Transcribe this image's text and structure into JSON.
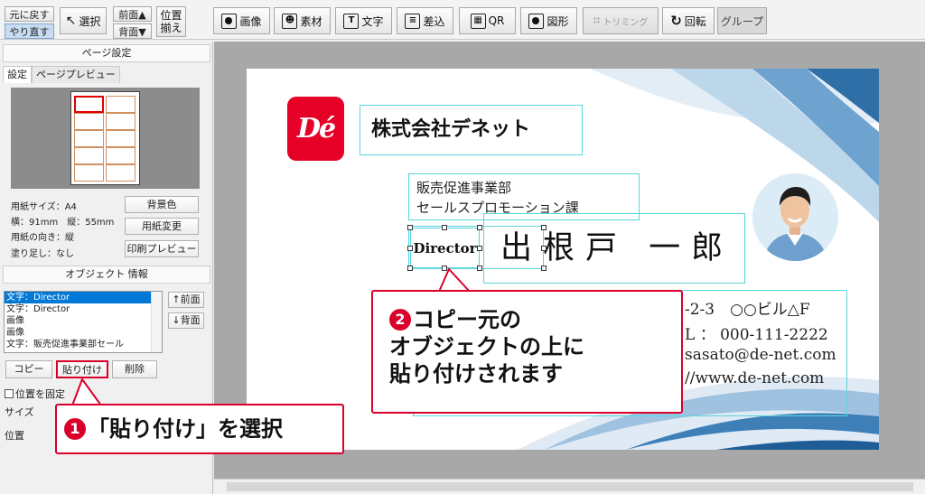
{
  "toolbar": {
    "undo": "元に戻す",
    "redo": "やり直す",
    "select": "選択",
    "bring_front": "前面▲",
    "send_back": "背面▼",
    "position_line1": "位置",
    "position_line2": "揃え",
    "image": "画像",
    "material": "素材",
    "text": "文字",
    "merge": "差込",
    "qr": "QR",
    "shape": "図形",
    "trim": "トリミング",
    "rotate": "回転",
    "group": "グループ",
    "text_icon": "T"
  },
  "page_settings": {
    "title": "ページ設定",
    "tabs": [
      "設定",
      "ページプレビュー"
    ],
    "paper_size": "用紙サイズ：A4",
    "dimensions": "横：91mm　縦：55mm",
    "orientation": "用紙の向き：縦",
    "bleed": "塗り足し：なし",
    "bg_color_button": "背景色",
    "change_paper_button": "用紙変更",
    "print_preview_button": "印刷プレビュー"
  },
  "object_info": {
    "title": "オブジェクト 情報",
    "list": [
      "文字：Director",
      "文字：Director",
      "画像",
      "画像",
      "文字：販売促進事業部セール"
    ],
    "front_button": "↑前面",
    "back_button": "↓背面",
    "copy_button": "コピー",
    "paste_button": "貼り付け",
    "delete_button": "削除",
    "lock_position": "位置を固定",
    "size_label": "サイズ",
    "position_label": "位置"
  },
  "card": {
    "logo": "Dé",
    "company": "株式会社デネット",
    "dept_line1": "販売促進事業部",
    "dept_line2": "セールスプロモーション課",
    "title": "Director",
    "name": "出根戸 一郎",
    "address": "-2-3　○○ビル△F",
    "tel": "L ： 000-111-2222",
    "email": "sasato@de-net.com",
    "url": "//www.de-net.com"
  },
  "callouts": {
    "step1_num": "1",
    "step1": "「貼り付け」を選択",
    "step2_num": "2",
    "step2_line1": "コピー元の",
    "step2_line2": "オブジェクトの上に",
    "step2_line3": "貼り付けされます"
  },
  "colors": {
    "accent": "#d9002c",
    "selection": "#5ad6dc",
    "list_selected": "#0078d7"
  }
}
